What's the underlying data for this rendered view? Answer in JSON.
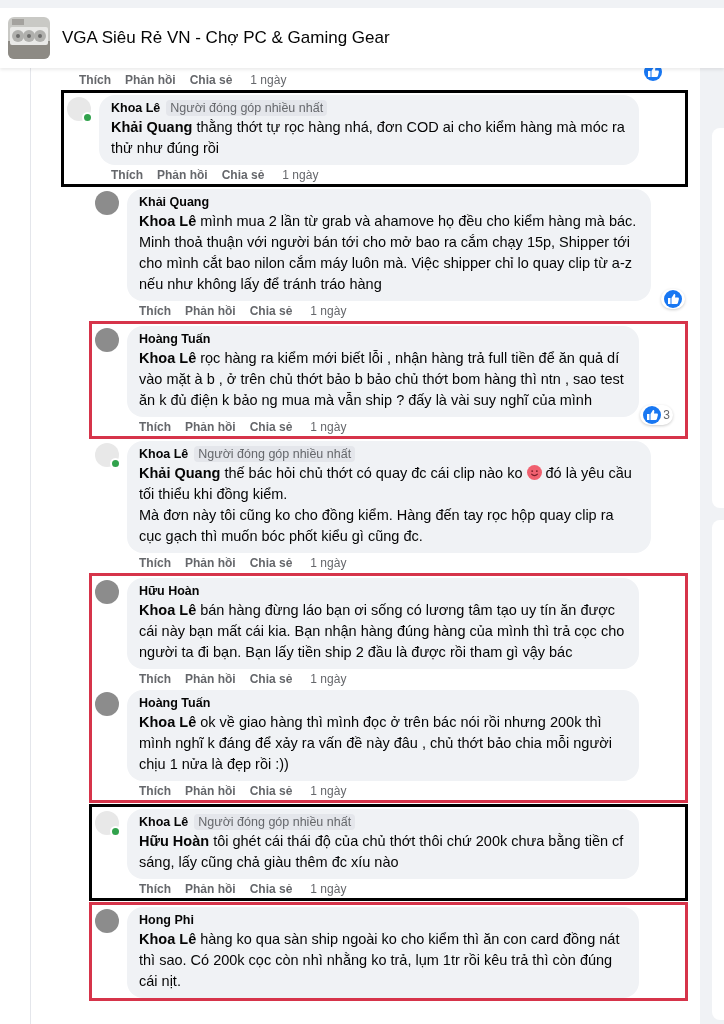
{
  "header": {
    "title": "VGA Siêu Rẻ VN - Chợ PC & Gaming Gear"
  },
  "thread": {
    "actions": {
      "like": "Thích",
      "reply": "Phản hồi",
      "share": "Chia sẻ",
      "time": "1 ngày"
    },
    "liked": true,
    "replies": [
      {
        "color": "#000000",
        "comment": {
          "name": "Khoa Lê",
          "badge": "Người đóng góp nhiều nhất",
          "online": true,
          "text": "**Khải Quang** thằng thớt tự rọc hàng nhá, đơn COD ai cho kiểm hàng mà móc ra thử như đúng rồi",
          "actions": {
            "like": "Thích",
            "reply": "Phản hồi",
            "share": "Chia sẻ",
            "time": "1 ngày"
          }
        },
        "groups": [
          {
            "comments": [
              {
                "name": "Khải Quang",
                "text": "**Khoa Lê** mình mua 2 lần từ grab và ahamove họ đều cho kiểm hàng mà bác. Minh thoả thuận với người bán tới cho mở bao ra cắm chạy 15p, Shipper tới cho mình cắt bao nilon cắm máy luôn mà. Việc shipper chỉ lo quay clip từ a-z nếu như không lấy để tránh tráo hàng",
                "liked": true,
                "actions": {
                  "like": "Thích",
                  "reply": "Phản hồi",
                  "share": "Chia sẻ",
                  "time": "1 ngày"
                }
              }
            ]
          },
          {
            "color": "#d6344a",
            "comments": [
              {
                "name": "Hoàng Tuấn",
                "text": "**Khoa Lê** rọc hàng ra kiểm mới biết lỗi , nhận hàng trả full tiền để ăn quả dí vào mặt à b , ở trên chủ thớt bảo b bảo chủ thớt bom hàng thì ntn , sao test ăn k đủ điện k bảo ng mua mà vẫn ship ? đấy là vài suy nghĩ của mình",
                "liked": true,
                "like_count": "3",
                "actions": {
                  "like": "Thích",
                  "reply": "Phản hồi",
                  "share": "Chia sẻ",
                  "time": "1 ngày"
                }
              }
            ]
          },
          {
            "comments": [
              {
                "name": "Khoa Lê",
                "badge": "Người đóng góp nhiều nhất",
                "online": true,
                "text": "**Khải Quang** thế bác hỏi chủ thớt có quay đc cái clip nào ko",
                "emoji": true,
                "text_after": "đó là yêu cầu tối thiểu khi đồng kiểm.\nMà đơn này tôi cũng ko cho đồng kiểm. Hàng đến tay rọc hộp quay clip ra cục gạch thì muốn bóc phốt kiểu gì cũng đc.",
                "actions": {
                  "like": "Thích",
                  "reply": "Phản hồi",
                  "share": "Chia sẻ",
                  "time": "1 ngày"
                }
              }
            ]
          },
          {
            "color": "#d6344a",
            "comments": [
              {
                "name": "Hữu Hoàn",
                "text": "**Khoa Lê** bán hàng đừng láo bạn ơi sống có lương tâm tạo uy tín ăn được cái này bạn mất cái kia. Bạn nhận hàng đúng hàng của mình thì trả cọc cho người ta đi bạn. Bạn lấy tiền ship 2 đầu là được rồi tham gì vậy bác",
                "actions": {
                  "like": "Thích",
                  "reply": "Phản hồi",
                  "share": "Chia sẻ",
                  "time": "1 ngày"
                }
              },
              {
                "name": "Hoàng Tuấn",
                "text": "**Khoa Lê** ok về giao hàng thì mình đọc ở trên bác nói rồi nhưng 200k thì mình nghĩ k đáng để xảy ra vấn đề này đâu , chủ thớt bảo chia mỗi người chịu 1 nửa là đẹp rồi :))",
                "actions": {
                  "like": "Thích",
                  "reply": "Phản hồi",
                  "share": "Chia sẻ",
                  "time": "1 ngày"
                }
              }
            ]
          },
          {
            "color": "#000000",
            "comments": [
              {
                "name": "Khoa Lê",
                "badge": "Người đóng góp nhiều nhất",
                "online": true,
                "text": "**Hữu Hoàn** tôi ghét cái thái độ của chủ thớt thôi chứ 200k chưa bằng tiền cf sáng, lấy cũng chả giàu thêm đc xíu nào",
                "actions": {
                  "like": "Thích",
                  "reply": "Phản hồi",
                  "share": "Chia sẻ",
                  "time": "1 ngày"
                }
              }
            ]
          },
          {
            "color": "#d6344a",
            "comments": [
              {
                "name": "Hong Phi",
                "text": "**Khoa Lê** hàng ko qua sàn ship ngoài ko cho kiểm thì ăn con card đồng nát thì sao. Có 200k cọc còn nhì nhằng ko trả, lụm 1tr rồi kêu trả thì còn đúng cái nịt."
              }
            ]
          }
        ]
      }
    ]
  }
}
